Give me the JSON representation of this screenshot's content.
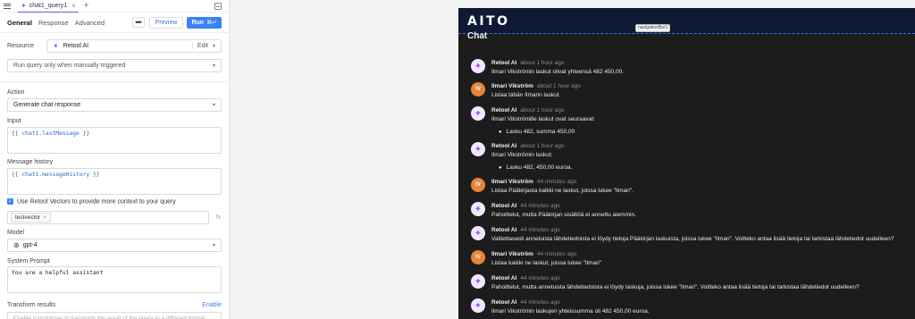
{
  "left": {
    "query_tab": "chat1_query1",
    "tabs": [
      "General",
      "Response",
      "Advanced"
    ],
    "more_label": "•••",
    "preview_label": "Preview",
    "run_label": "Run",
    "run_shortcut": "⌘↵",
    "resource_label": "Resource",
    "resource_value": "Retool AI",
    "edit_label": "Edit",
    "trigger_value": "Run query only when manually triggered",
    "action_label": "Action",
    "action_value": "Generate chat response",
    "input_label": "Input",
    "input_open": "{{",
    "input_var": "chat1.lastMessage",
    "input_close": "}}",
    "history_label": "Message history",
    "history_open": "{{",
    "history_var": "chat1.messageHistory",
    "history_close": "}}",
    "vectors_label": "Use Retool Vectors to provide more context to your query",
    "vector_chip": "testvector",
    "fx_label": "fx",
    "model_label": "Model",
    "model_value": "gpt-4",
    "system_prompt_label": "System Prompt",
    "system_prompt_value": "You are a helpful assistant",
    "transform_label": "Transform results",
    "transform_enable": "Enable",
    "transform_hint": "Enable transformer to transform the result of the query to a different format"
  },
  "right": {
    "logo": "AITO",
    "nav_tag": "navigationBar1",
    "chat_title": "Chat",
    "messages": [
      {
        "avatar": "ai",
        "name": "Retool AI",
        "time": "about 1 hour ago",
        "lines": [
          "Ilmari Vikströmin laskut olivat yhteensä 482 450,00."
        ],
        "bullets": []
      },
      {
        "avatar": "user",
        "initials": "IV",
        "name": "Ilmari Vikström",
        "time": "about 1 hour ago",
        "lines": [
          "Listaa tähän Ilmarin laskut."
        ],
        "bullets": []
      },
      {
        "avatar": "ai",
        "name": "Retool AI",
        "time": "about 1 hour ago",
        "lines": [
          "Ilmari Vikströmille laskut ovat seuraavat:"
        ],
        "bullets": [
          "Lasku 482, summa 450,00"
        ]
      },
      {
        "avatar": "ai",
        "name": "Retool AI",
        "time": "about 1 hour ago",
        "lines": [
          "Ilmari Vikströmin laskut:"
        ],
        "bullets": [
          "Lasku 482, 450,00 euroa."
        ]
      },
      {
        "avatar": "user",
        "initials": "IV",
        "name": "Ilmari Vikström",
        "time": "44 minutes ago",
        "lines": [
          "Listaa Pääkirjasta kaikki ne laskut, joissa lukee \"Ilmari\"."
        ],
        "bullets": []
      },
      {
        "avatar": "ai",
        "name": "Retool AI",
        "time": "44 minutes ago",
        "lines": [
          "Pahoittelut, mutta Pääkirjan sisältöä ei annettu aiemmin."
        ],
        "bullets": []
      },
      {
        "avatar": "ai",
        "name": "Retool AI",
        "time": "44 minutes ago",
        "lines": [
          "Valitettavasti annetuista lähdetiedoista ei löydy tietoja Pääkirjan laskuista, joissa lukee \"Ilmari\". Voitteko antaa lisää tietoja tai tarkistaa lähdetiedot uudelleen?"
        ],
        "bullets": []
      },
      {
        "avatar": "user",
        "initials": "IV",
        "name": "Ilmari Vikström",
        "time": "44 minutes ago",
        "lines": [
          "Listaa kaikki ne laskut, joissa lukee \"Ilmari\""
        ],
        "bullets": []
      },
      {
        "avatar": "ai",
        "name": "Retool AI",
        "time": "44 minutes ago",
        "lines": [
          "Pahoittelut, mutta annetuista lähdetiedoista ei löydy laskuja, joissa lukee \"Ilmari\". Voitteko antaa lisää tietoja tai tarkistaa lähdetiedot uudelleen?"
        ],
        "bullets": []
      },
      {
        "avatar": "ai",
        "name": "Retool AI",
        "time": "44 minutes ago",
        "lines": [
          "Ilmari Vikströmin laskujen yhteissumma oli 482 450,00 euroa."
        ],
        "bullets": []
      }
    ]
  }
}
